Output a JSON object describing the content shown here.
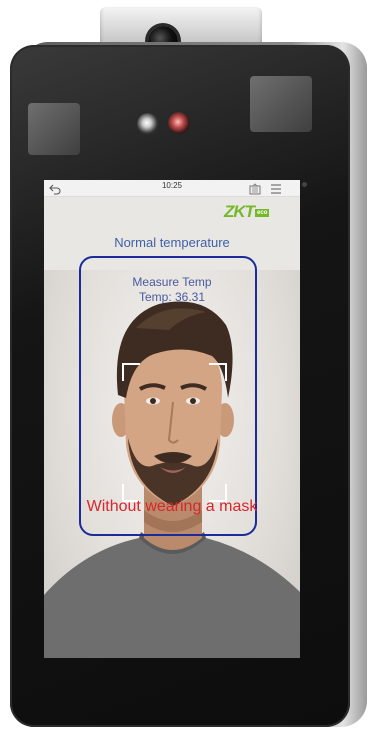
{
  "status_bar": {
    "time": "10:25",
    "back_icon": "back-arrow-icon",
    "menu_icon": "menu-icon",
    "list_icon": "list-icon"
  },
  "brand": {
    "logo_text": "ZKT",
    "logo_suffix": "eco",
    "color": "#76b82a"
  },
  "detection": {
    "temperature_status": "Normal temperature",
    "measure_label": "Measure Temp",
    "temp_reading": "Temp: 36.31",
    "mask_warning": "Without wearing a mask",
    "frame_color": "#1c2a9a",
    "warning_color": "#d8262b"
  }
}
